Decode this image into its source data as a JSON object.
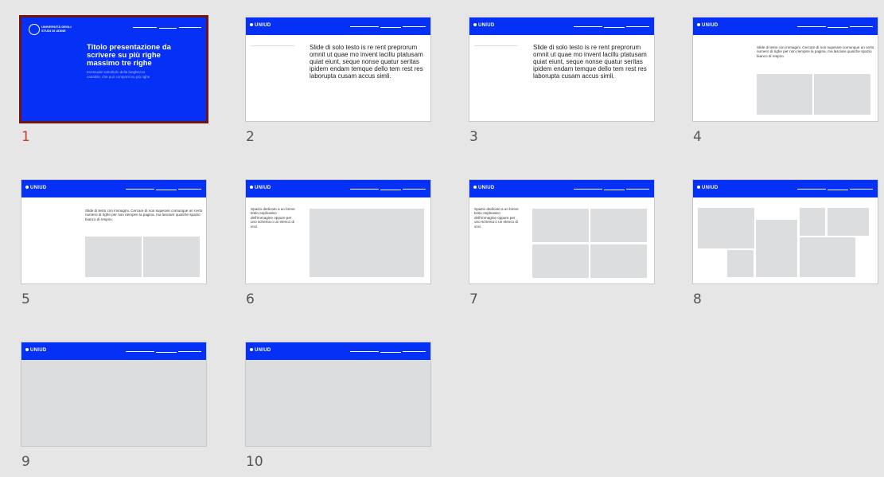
{
  "slides": [
    {
      "number": "1",
      "type": "title",
      "brand": "UNIVERSITÀ DEGLI STUDI DI UDINE",
      "title": "Titolo presentazione da scrivere su più righe massimo tre righe",
      "subtitle": "Eventuale sottotitolo della lunghezza variabile, che può comporsi su più righe"
    },
    {
      "number": "2",
      "type": "text",
      "brand": "UNIUD",
      "text": "Slide di solo testo is re rent preprorum omnit ut quae mo invent lacillu ptatusam quiat eiunt, seque nonse quatur seritas ipidem endam temque dello tem rest res laborupta cusam accus simli."
    },
    {
      "number": "3",
      "type": "text",
      "brand": "UNIUD",
      "text": "Slide di solo testo is re rent preprorum omnit ut quae mo invent lacillu ptatusam quiat eiunt, seque nonse quatur seritas ipidem endam temque dello tem rest res laborupta cusam accus simli."
    },
    {
      "number": "4",
      "type": "text-images",
      "brand": "UNIUD",
      "text": "Slide di testo con immagini. Cercare di non superare comunque un certo numero di righe per non riempire la pagina, ma lasciare qualche spazio bianco di respiro."
    },
    {
      "number": "5",
      "type": "text-images",
      "brand": "UNIUD",
      "text": "Slide di testo con immagini. Cercare di non superare comunque un certo numero di righe per non riempire la pagina, ma lasciare qualche spazio bianco di respiro."
    },
    {
      "number": "6",
      "type": "side-text-1",
      "brand": "UNIUD",
      "text": "Spazio dedicato a un breve testo esplicativo dell'immagine oppure per uno schema o un elenco di voci."
    },
    {
      "number": "7",
      "type": "side-text-4",
      "brand": "UNIUD",
      "text": "Spazio dedicato a un breve testo esplicativo dell'immagine oppure per uno schema o un elenco di voci."
    },
    {
      "number": "8",
      "type": "collage",
      "brand": "UNIUD"
    },
    {
      "number": "9",
      "type": "full-image",
      "brand": "UNIUD"
    },
    {
      "number": "10",
      "type": "full-image",
      "brand": "UNIUD"
    }
  ]
}
